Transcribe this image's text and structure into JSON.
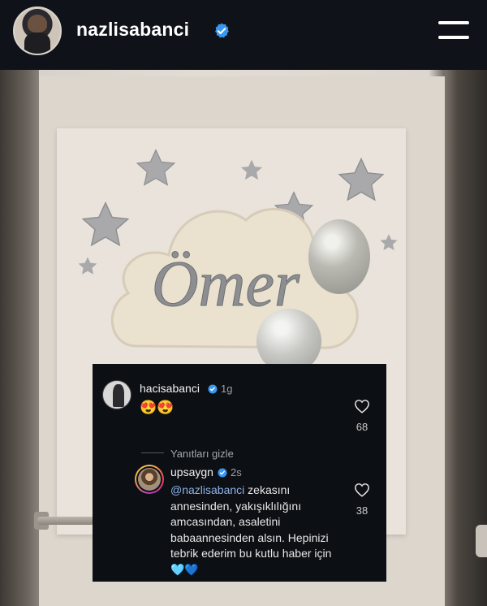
{
  "header": {
    "username": "nazlisabanci",
    "verified_icon": "verified-badge-icon",
    "menu_icon": "hamburger-menu-icon"
  },
  "photo": {
    "name_sign": "Ömer"
  },
  "comments": {
    "comment": {
      "username": "hacisabanci",
      "time": "1g",
      "text": "😍😍",
      "likes": "68"
    },
    "hide_replies_label": "Yanıtları gizle",
    "reply": {
      "username": "upsaygn",
      "time": "2s",
      "mention": "@nazlisabanci",
      "text_after_mention": " zekasını annesinden, yakışıklılığını amcasından, asaletini babaannesinden alsın. Hepinizi tebrik ederim bu kutlu haber için 🩵💙",
      "likes": "38"
    }
  },
  "colors": {
    "verified_blue": "#3897f0",
    "mention_blue": "#8fb2e8",
    "panel_bg": "#0c0f13"
  }
}
